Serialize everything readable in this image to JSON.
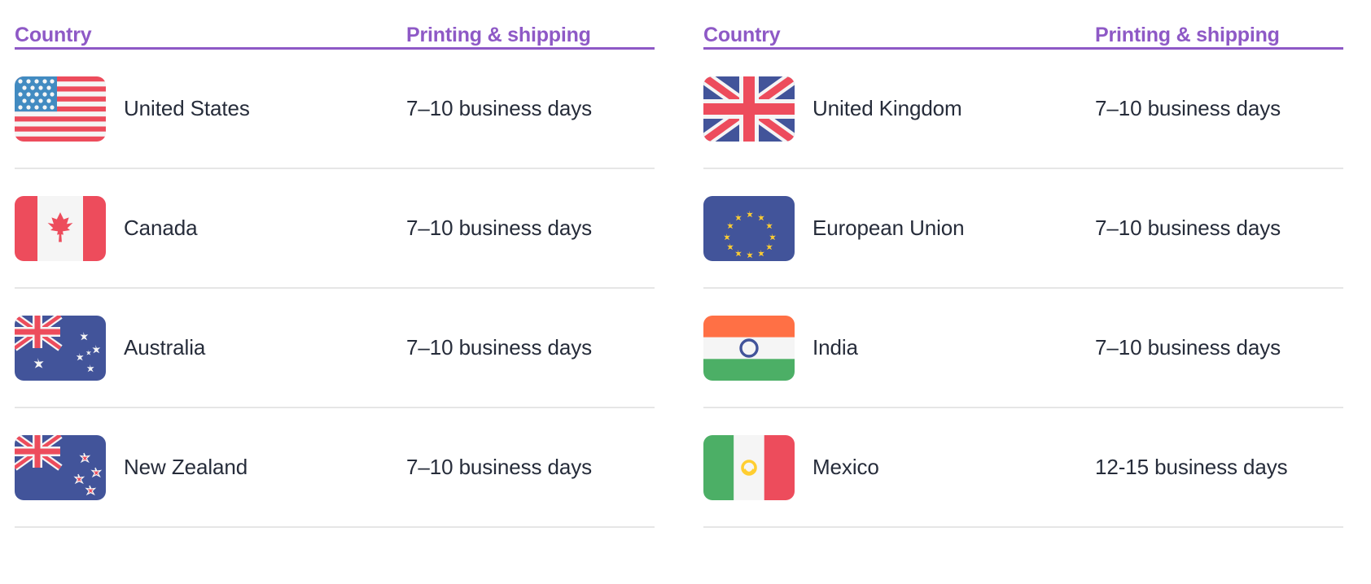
{
  "tables": [
    {
      "id": "table-left",
      "headers": {
        "country": "Country",
        "shipping": "Printing & shipping"
      },
      "rows": [
        {
          "flag": "flag-us-icon",
          "country": "United States",
          "shipping": "7–10 business days"
        },
        {
          "flag": "flag-ca-icon",
          "country": "Canada",
          "shipping": "7–10 business days"
        },
        {
          "flag": "flag-au-icon",
          "country": "Australia",
          "shipping": "7–10 business days"
        },
        {
          "flag": "flag-nz-icon",
          "country": "New Zealand",
          "shipping": "7–10 business days"
        }
      ]
    },
    {
      "id": "table-right",
      "headers": {
        "country": "Country",
        "shipping": "Printing & shipping"
      },
      "rows": [
        {
          "flag": "flag-gb-icon",
          "country": "United Kingdom",
          "shipping": "7–10 business days"
        },
        {
          "flag": "flag-eu-icon",
          "country": "European Union",
          "shipping": "7–10 business days"
        },
        {
          "flag": "flag-in-icon",
          "country": "India",
          "shipping": "7–10 business days"
        },
        {
          "flag": "flag-mx-icon",
          "country": "Mexico",
          "shipping": "12-15 business days"
        }
      ]
    }
  ],
  "colors": {
    "header_purple": "#8e59c6",
    "header_rule": "#8e59c6",
    "row_rule": "#e6e6e6",
    "body_text": "#262c3a",
    "background": "#ffffff",
    "flag_red": "#ed4c5c",
    "flag_blue": "#428bc1",
    "flag_navy": "#42549a",
    "flag_white": "#f5f5f5",
    "flag_green": "#4caf66",
    "flag_saffron": "#ff7045",
    "flag_yellow": "#ffce31",
    "flag_chakra": "#42549a"
  }
}
